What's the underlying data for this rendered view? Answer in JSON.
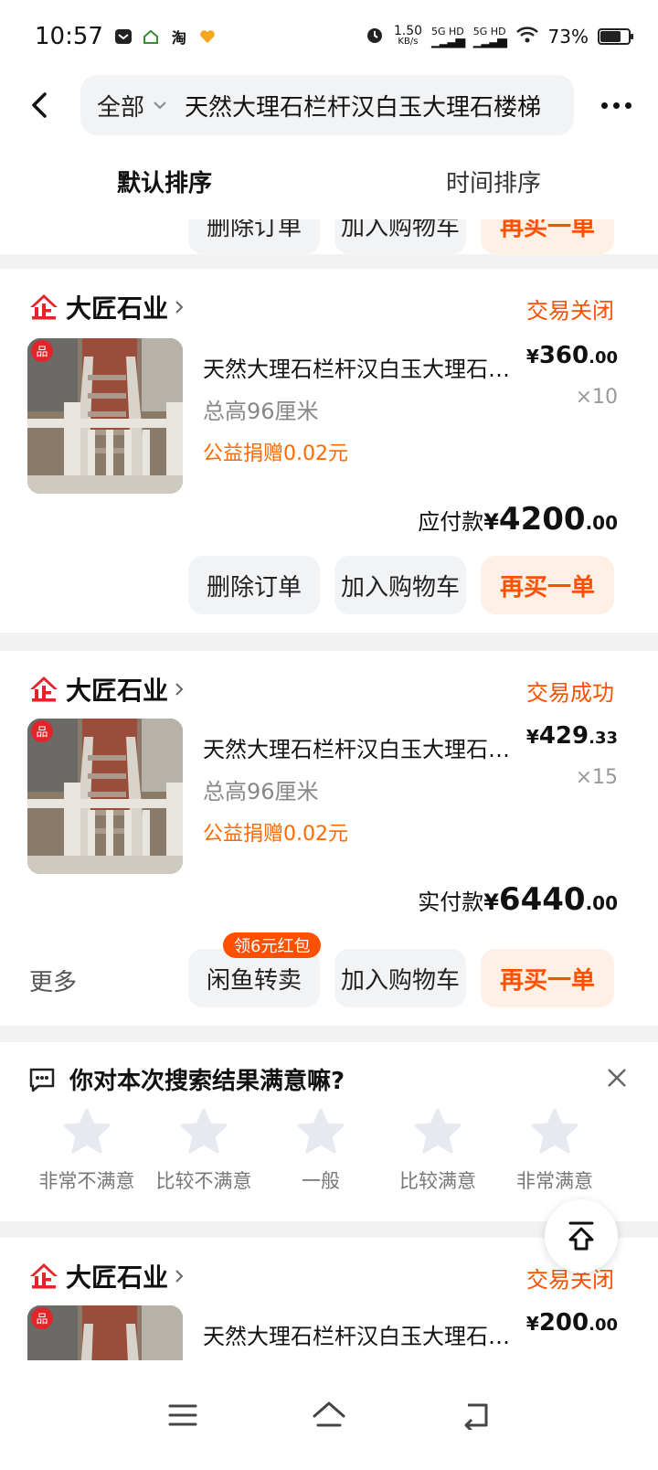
{
  "status_bar": {
    "time": "10:57",
    "speed_value": "1.50",
    "speed_unit": "KB/s",
    "net1": "5G HD",
    "net2": "5G HD",
    "battery": "73%",
    "icons": [
      "message-icon",
      "home-app-icon",
      "taobao-icon",
      "heart-app-icon",
      "alarm-icon",
      "signal-icon",
      "wifi-icon",
      "battery-icon"
    ]
  },
  "header": {
    "scope": "全部",
    "query": "天然大理石栏杆汉白玉大理石楼梯"
  },
  "sort_tabs": [
    {
      "label": "默认排序",
      "active": true
    },
    {
      "label": "时间排序",
      "active": false
    }
  ],
  "partial_buttons": [
    "删除订单",
    "加入购物车",
    "再买一单"
  ],
  "orders": [
    {
      "shop": "大匠石业",
      "status": "交易关闭",
      "title": "天然大理石栏杆汉白玉大理石楼梯",
      "sku": "总高96厘米",
      "charity": "公益捐赠0.02元",
      "price_cur": "¥",
      "price_int": "360",
      "price_dec": ".00",
      "qty": "×10",
      "total_label": "应付款",
      "total_cur": "¥",
      "total_int": "4200",
      "total_dec": ".00",
      "buttons": [
        "删除订单",
        "加入购物车",
        "再买一单"
      ]
    },
    {
      "shop": "大匠石业",
      "status": "交易成功",
      "title": "天然大理石栏杆汉白玉大理石楼梯",
      "sku": "总高96厘米",
      "charity": "公益捐赠0.02元",
      "price_cur": "¥",
      "price_int": "429",
      "price_dec": ".33",
      "qty": "×15",
      "total_label": "实付款",
      "total_cur": "¥",
      "total_int": "6440",
      "total_dec": ".00",
      "more": "更多",
      "badge": "领6元红包",
      "buttons": [
        "闲鱼转卖",
        "加入购物车",
        "再买一单"
      ]
    },
    {
      "shop": "大匠石业",
      "status": "交易关闭",
      "title": "天然大理石栏杆汉白玉大理石楼梯",
      "price_cur": "¥",
      "price_int": "200",
      "price_dec": ".00"
    }
  ],
  "feedback": {
    "question": "你对本次搜索结果满意嘛?",
    "ratings": [
      "非常不满意",
      "比较不满意",
      "一般",
      "比较满意",
      "非常满意"
    ]
  },
  "colors": {
    "accent": "#ff5000",
    "brand_red": "#e4242b",
    "button_bg": "#f2f3f5",
    "orange_button_bg": "#fff0e6"
  }
}
